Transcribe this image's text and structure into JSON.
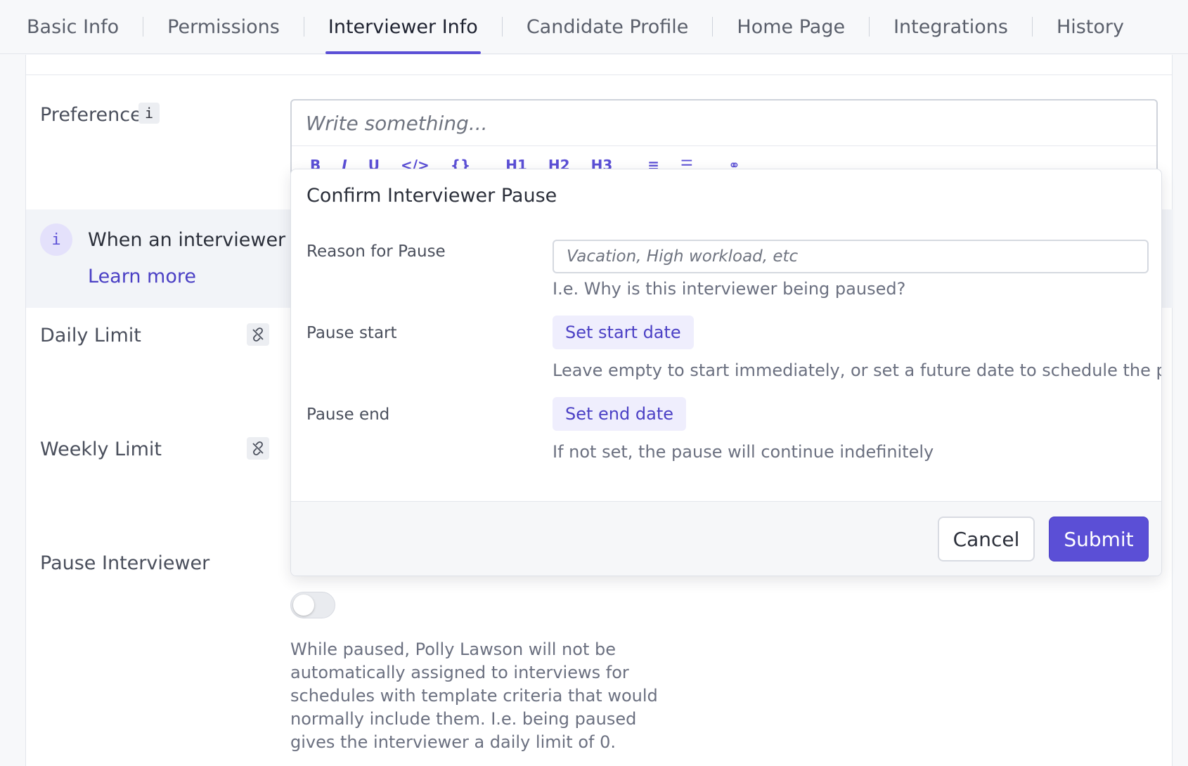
{
  "tabs": [
    {
      "label": "Basic Info"
    },
    {
      "label": "Permissions"
    },
    {
      "label": "Interviewer Info"
    },
    {
      "label": "Candidate Profile"
    },
    {
      "label": "Home Page"
    },
    {
      "label": "Integrations"
    },
    {
      "label": "History"
    }
  ],
  "active_tab": "Interviewer Info",
  "preferences": {
    "label": "Preferences",
    "info_glyph": "i",
    "placeholder": "Write something...",
    "toolbar_icons": [
      "bold-icon",
      "italic-icon",
      "underline-icon",
      "code-icon",
      "code-block-icon",
      "h1-icon",
      "h2-icon",
      "h3-icon",
      "ordered-list-icon",
      "bullet-list-icon",
      "link-icon"
    ]
  },
  "banner": {
    "text": "When an interviewer ha",
    "link": "Learn more"
  },
  "limits": {
    "daily_label": "Daily Limit",
    "weekly_label": "Weekly Limit"
  },
  "pause": {
    "label": "Pause Interviewer",
    "toggle_on": false,
    "description": "While paused, Polly Lawson will not be automatically assigned to interviews for schedules with template criteria that would normally include them. I.e. being paused gives the interviewer a daily limit of 0."
  },
  "modal": {
    "title": "Confirm Interviewer Pause",
    "reason_label": "Reason for Pause",
    "reason_placeholder": "Vacation, High workload, etc",
    "reason_help": "I.e. Why is this interviewer being paused?",
    "start_label": "Pause start",
    "start_button": "Set start date",
    "start_help": "Leave empty to start immediately, or set a future date to schedule the pause",
    "end_label": "Pause end",
    "end_button": "Set end date",
    "end_help": "If not set, the pause will continue indefinitely",
    "cancel": "Cancel",
    "submit": "Submit"
  },
  "colors": {
    "accent": "#5b4fd6",
    "link": "#4b40c5"
  }
}
